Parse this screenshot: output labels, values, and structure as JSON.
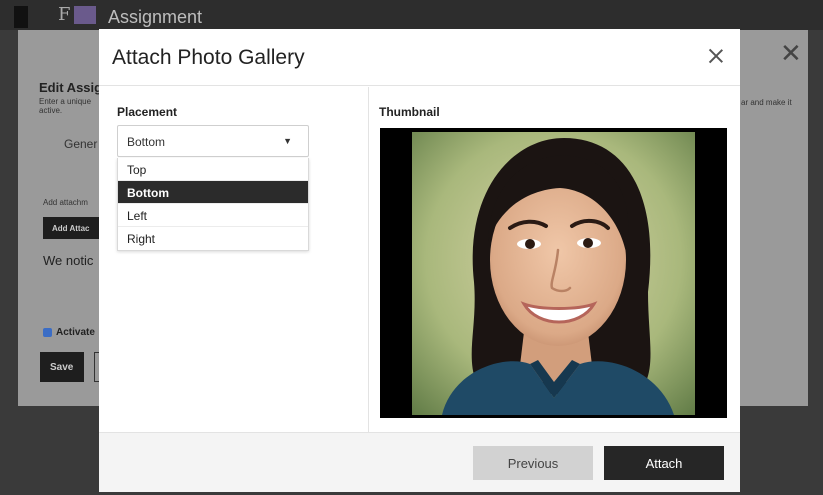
{
  "background": {
    "topbar": {
      "mark": "F",
      "title": "Assignment"
    },
    "panel": {
      "heading": "Edit Assig",
      "description": "Enter a unique active.",
      "description_right": "ar and make it",
      "general_label": "Gener",
      "add_attachment_text": "Add attachm",
      "add_attachment_button": "Add Attac",
      "notice_text": "We notic",
      "activate_label": "Activate",
      "save_button": "Save"
    }
  },
  "modal": {
    "title": "Attach Photo Gallery",
    "placement": {
      "label": "Placement",
      "selected": "Bottom",
      "options": [
        "Top",
        "Bottom",
        "Left",
        "Right"
      ]
    },
    "thumbnail": {
      "label": "Thumbnail"
    },
    "buttons": {
      "previous": "Previous",
      "attach": "Attach"
    }
  },
  "icons": {
    "close": "close-icon",
    "dropdown": "chevron-down-icon",
    "checkbox": "checkbox-checked-icon"
  }
}
